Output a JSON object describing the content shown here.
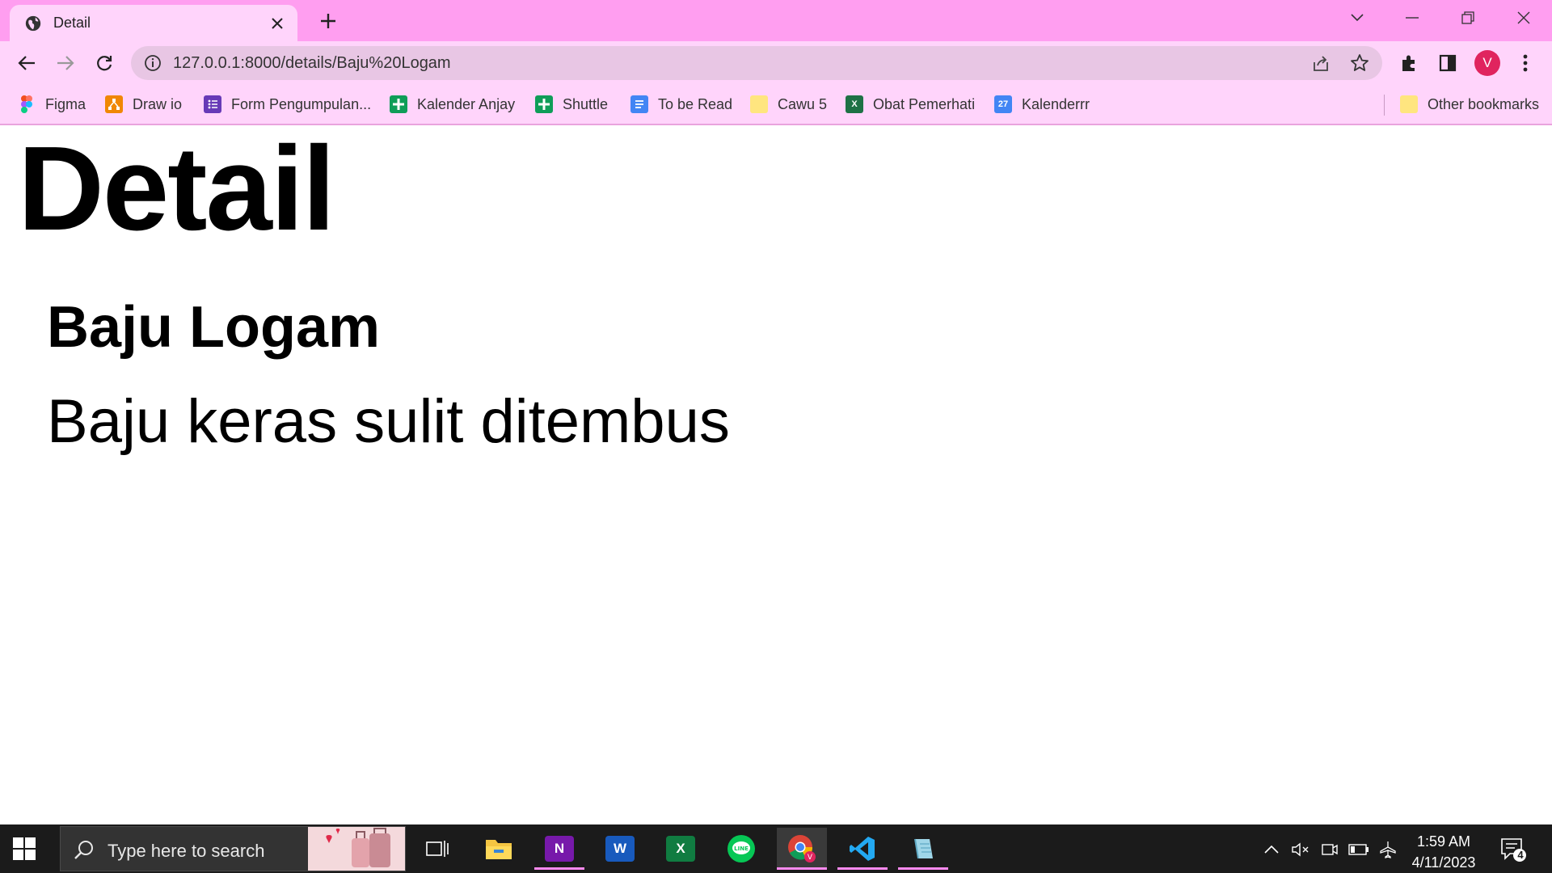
{
  "tab": {
    "title": "Detail"
  },
  "omnibox": {
    "url": "127.0.0.1:8000/details/Baju%20Logam"
  },
  "profile": {
    "initial": "V"
  },
  "bookmarks": [
    {
      "label": "Figma",
      "icon": "figma-icon",
      "color": "#a259ff"
    },
    {
      "label": "Draw io",
      "icon": "drawio-icon",
      "color": "#f08705"
    },
    {
      "label": "Form Pengumpulan...",
      "icon": "forms-icon",
      "color": "#673ab7"
    },
    {
      "label": "Kalender Anjay",
      "icon": "sheets-icon",
      "color": "#0f9d58"
    },
    {
      "label": "Shuttle",
      "icon": "sheets-icon",
      "color": "#0f9d58"
    },
    {
      "label": "To be Read",
      "icon": "docs-icon",
      "color": "#4285f4"
    },
    {
      "label": "Cawu 5",
      "icon": "folder-icon",
      "color": "#ffe57f"
    },
    {
      "label": "Obat Pemerhati",
      "icon": "excel-icon",
      "color": "#1e7145"
    },
    {
      "label": "Kalenderrr",
      "icon": "calendar-icon",
      "color": "#4285f4"
    }
  ],
  "other_bookmarks": "Other bookmarks",
  "page": {
    "heading": "Detail",
    "item_name": "Baju Logam",
    "item_description": "Baju keras sulit ditembus"
  },
  "taskbar": {
    "search_placeholder": "Type here to search",
    "time": "1:59 AM",
    "date": "4/11/2023",
    "notification_count": "4"
  },
  "colors": {
    "tabstrip": "#ff9ef0",
    "toolbar": "#ffd4fb",
    "omnibox": "#e8c6e4",
    "avatar": "#e0245e",
    "taskbar": "#1b1b1b"
  }
}
